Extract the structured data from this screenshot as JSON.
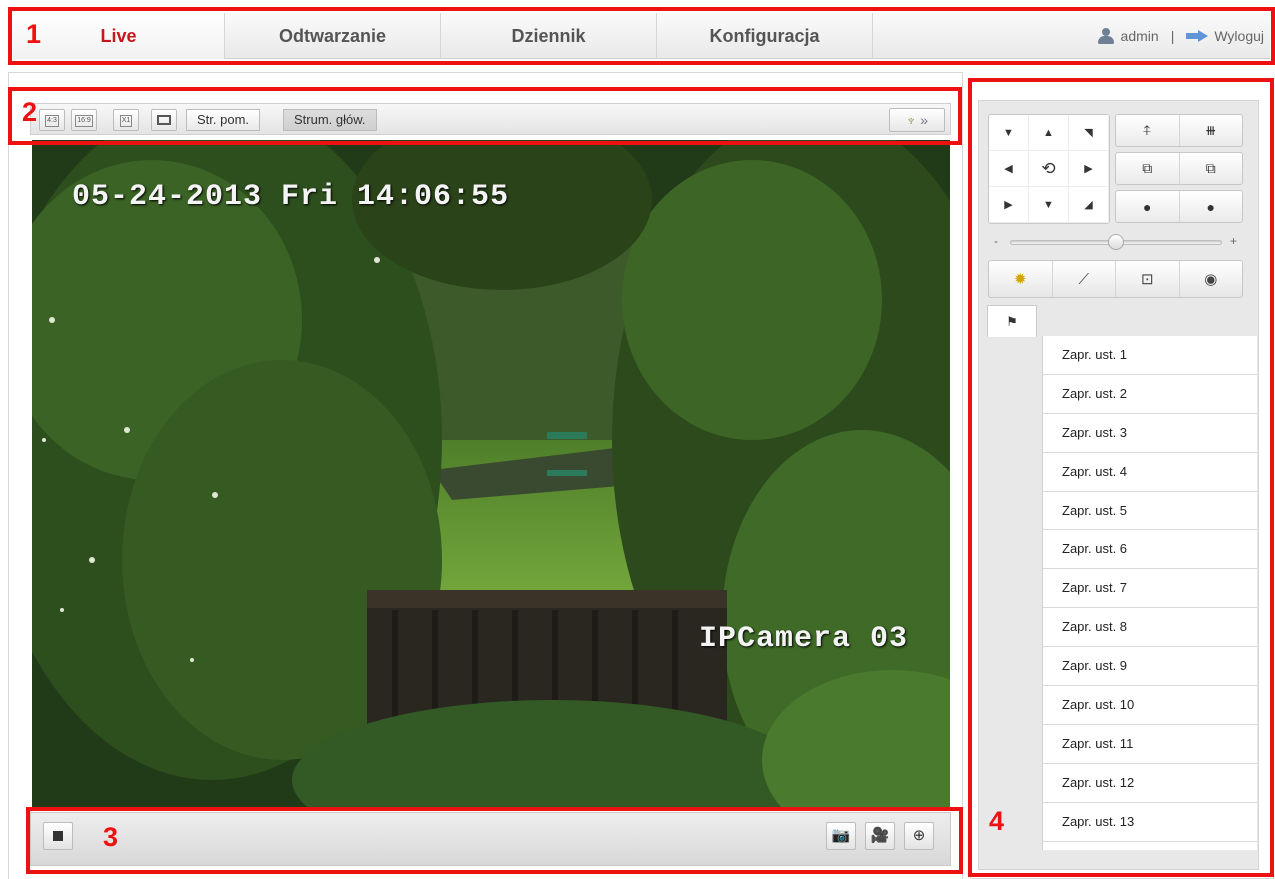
{
  "nav": {
    "tabs": [
      {
        "label": "Live",
        "active": true
      },
      {
        "label": "Odtwarzanie",
        "active": false
      },
      {
        "label": "Dziennik",
        "active": false
      },
      {
        "label": "Konfiguracja",
        "active": false
      }
    ],
    "user": "admin",
    "separator": "|",
    "logout": "Wyloguj"
  },
  "annotations": [
    "1",
    "2",
    "3",
    "4"
  ],
  "toolbar": {
    "ratio_4_3": "4:3",
    "ratio_16_9": "16:9",
    "ratio_x1": "X1",
    "stream_sub": "Str. pom.",
    "stream_main": "Strum. głów.",
    "ptz_more": "»"
  },
  "video": {
    "timestamp": "05-24-2013 Fri 14:06:55",
    "camera_name": "IPCamera 03"
  },
  "ptz": {
    "speed_minus": "-",
    "speed_plus": "+",
    "speed_level": 0.5,
    "presets": [
      "Zapr. ust. 1",
      "Zapr. ust. 2",
      "Zapr. ust. 3",
      "Zapr. ust. 4",
      "Zapr. ust. 5",
      "Zapr. ust. 6",
      "Zapr. ust. 7",
      "Zapr. ust. 8",
      "Zapr. ust. 9",
      "Zapr. ust. 10",
      "Zapr. ust. 11",
      "Zapr. ust. 12",
      "Zapr. ust. 13"
    ]
  },
  "colors": {
    "annotation": "#ee1111",
    "active_tab": "#c8161d"
  }
}
